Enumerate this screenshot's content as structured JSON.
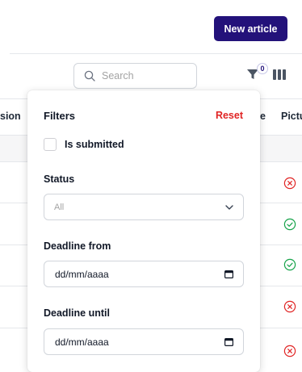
{
  "toolbar": {
    "new_article_label": "New article",
    "search_placeholder": "Search",
    "filter_count": "0",
    "accent_color": "#23127a"
  },
  "table": {
    "headers": [
      "sion",
      "e",
      "Pictu"
    ],
    "rows": [
      {
        "status": "x-circle-icon",
        "color": "#e02424"
      },
      {
        "status": "check-circle-icon",
        "color": "#16a34a"
      },
      {
        "status": "check-circle-icon",
        "color": "#16a34a"
      },
      {
        "status": "x-circle-icon",
        "color": "#e02424"
      },
      {
        "status": "x-circle-icon",
        "color": "#e02424"
      }
    ]
  },
  "filters": {
    "title": "Filters",
    "reset_label": "Reset",
    "is_submitted_label": "Is submitted",
    "status_label": "Status",
    "status_value": "All",
    "deadline_from_label": "Deadline from",
    "deadline_from_value": "dd/mm/aaaa",
    "deadline_until_label": "Deadline until",
    "deadline_until_value": "dd/mm/aaaa",
    "reset_color": "#e02424"
  }
}
